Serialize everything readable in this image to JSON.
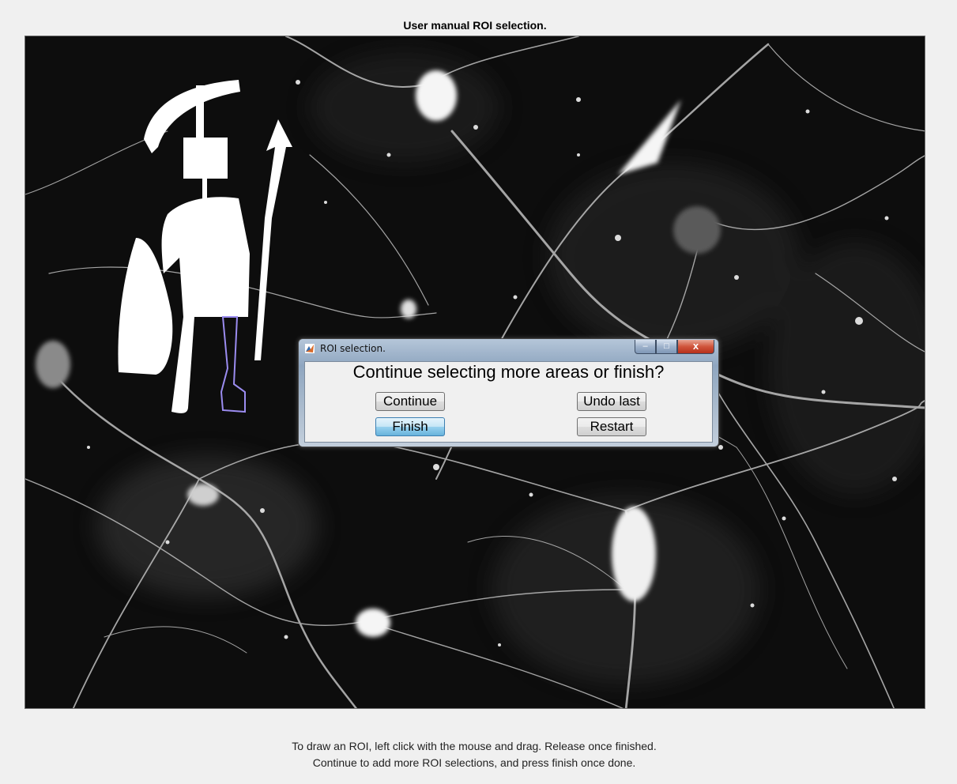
{
  "figure": {
    "title": "User manual ROI selection."
  },
  "instructions": {
    "line1": "To draw an ROI, left click with the mouse and drag. Release once finished.",
    "line2": "Continue to add more ROI selections, and press finish once done."
  },
  "dialog": {
    "title": "ROI selection.",
    "question": "Continue selecting more areas or finish?",
    "buttons": {
      "continue": "Continue",
      "undo_last": "Undo last",
      "finish": "Finish",
      "restart": "Restart"
    },
    "window_controls": {
      "minimize": "–",
      "maximize": "□",
      "close": "x"
    }
  },
  "colors": {
    "focused_button": "#68b3db",
    "close_button": "#c7452b",
    "roi_outline": "#9b8cf0"
  }
}
